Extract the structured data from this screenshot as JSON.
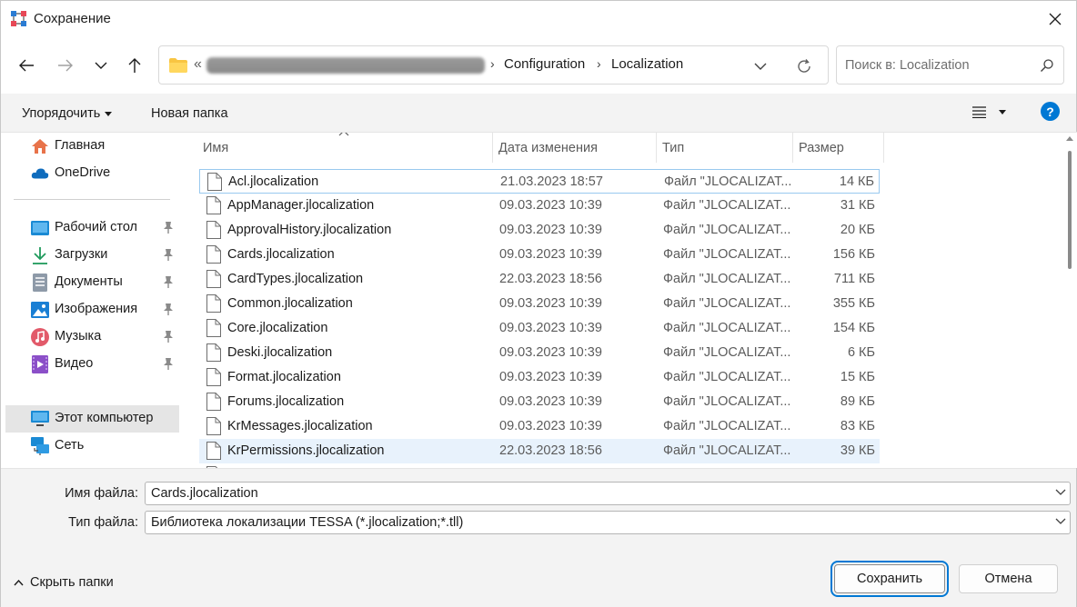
{
  "window": {
    "title": "Сохранение"
  },
  "address": {
    "prefix": "«",
    "segments": [
      "Configuration",
      "Localization"
    ]
  },
  "search": {
    "placeholder": "Поиск в: Localization"
  },
  "toolbar": {
    "organize_label": "Упорядочить",
    "new_folder_label": "Новая папка",
    "help_label": "?"
  },
  "sidebar": {
    "items": [
      {
        "label": "Главная",
        "icon": "home-icon"
      },
      {
        "label": "OneDrive",
        "icon": "cloud-icon"
      },
      {
        "label": "Рабочий стол",
        "icon": "desktop-icon",
        "pinned": true
      },
      {
        "label": "Загрузки",
        "icon": "download-icon",
        "pinned": true
      },
      {
        "label": "Документы",
        "icon": "documents-icon",
        "pinned": true
      },
      {
        "label": "Изображения",
        "icon": "pictures-icon",
        "pinned": true
      },
      {
        "label": "Музыка",
        "icon": "music-icon",
        "pinned": true
      },
      {
        "label": "Видео",
        "icon": "video-icon",
        "pinned": true
      },
      {
        "label": "Этот компьютер",
        "icon": "computer-icon",
        "selected": true
      },
      {
        "label": "Сеть",
        "icon": "network-icon"
      }
    ]
  },
  "columns": {
    "name": "Имя",
    "date": "Дата изменения",
    "type": "Тип",
    "size": "Размер"
  },
  "files": [
    {
      "name": "Acl.jlocalization",
      "date": "21.03.2023 18:57",
      "type": "Файл \"JLOCALIZAT...",
      "size": "14 КБ"
    },
    {
      "name": "AppManager.jlocalization",
      "date": "09.03.2023 10:39",
      "type": "Файл \"JLOCALIZAT...",
      "size": "31 КБ"
    },
    {
      "name": "ApprovalHistory.jlocalization",
      "date": "09.03.2023 10:39",
      "type": "Файл \"JLOCALIZAT...",
      "size": "20 КБ"
    },
    {
      "name": "Cards.jlocalization",
      "date": "09.03.2023 10:39",
      "type": "Файл \"JLOCALIZAT...",
      "size": "156 КБ"
    },
    {
      "name": "CardTypes.jlocalization",
      "date": "22.03.2023 18:56",
      "type": "Файл \"JLOCALIZAT...",
      "size": "711 КБ"
    },
    {
      "name": "Common.jlocalization",
      "date": "09.03.2023 10:39",
      "type": "Файл \"JLOCALIZAT...",
      "size": "355 КБ"
    },
    {
      "name": "Core.jlocalization",
      "date": "09.03.2023 10:39",
      "type": "Файл \"JLOCALIZAT...",
      "size": "154 КБ"
    },
    {
      "name": "Deski.jlocalization",
      "date": "09.03.2023 10:39",
      "type": "Файл \"JLOCALIZAT...",
      "size": "6 КБ"
    },
    {
      "name": "Format.jlocalization",
      "date": "09.03.2023 10:39",
      "type": "Файл \"JLOCALIZAT...",
      "size": "15 КБ"
    },
    {
      "name": "Forums.jlocalization",
      "date": "09.03.2023 10:39",
      "type": "Файл \"JLOCALIZAT...",
      "size": "89 КБ"
    },
    {
      "name": "KrMessages.jlocalization",
      "date": "09.03.2023 10:39",
      "type": "Файл \"JLOCALIZAT...",
      "size": "83 КБ"
    },
    {
      "name": "KrPermissions.jlocalization",
      "date": "22.03.2023 18:56",
      "type": "Файл \"JLOCALIZAT...",
      "size": "39 КБ"
    }
  ],
  "form": {
    "filename_label": "Имя файла:",
    "filename_value": "Cards.jlocalization",
    "filetype_label": "Тип файла:",
    "filetype_value": "Библиотека локализации TESSA (*.jlocalization;*.tll)"
  },
  "footer": {
    "hide_folders_label": "Скрыть папки",
    "save_label": "Сохранить",
    "cancel_label": "Отмена"
  },
  "colors": {
    "accent": "#0078d4",
    "selected_row": "#e8f2fc",
    "focus_border": "#99c9ef"
  }
}
